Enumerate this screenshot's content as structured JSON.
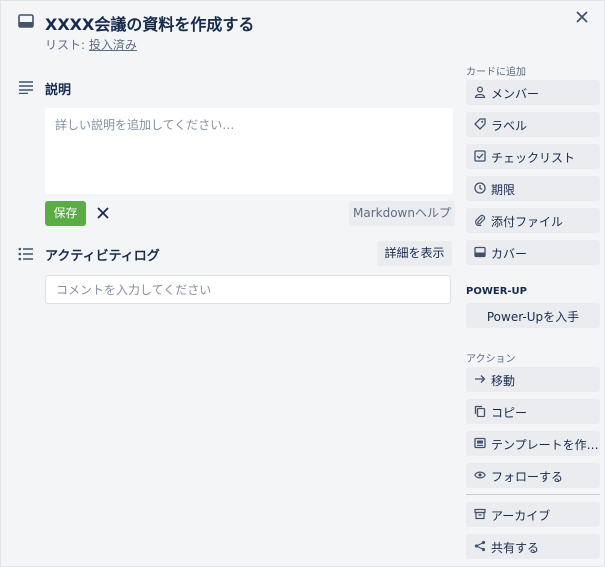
{
  "card": {
    "title": "XXXX会議の資料を作成する",
    "list_prefix": "リスト: ",
    "list_name": "投入済み"
  },
  "description": {
    "heading": "説明",
    "placeholder": "詳しい説明を追加してください…",
    "save_label": "保存",
    "markdown_help_label": "Markdownヘルプ"
  },
  "activity": {
    "heading": "アクティビティログ",
    "show_details_label": "詳細を表示",
    "comment_placeholder": "コメントを入力してください"
  },
  "sidebar": {
    "add_to_card_heading": "カードに追加",
    "add_items": [
      {
        "label": "メンバー",
        "icon": "person-icon"
      },
      {
        "label": "ラベル",
        "icon": "tag-icon"
      },
      {
        "label": "チェックリスト",
        "icon": "checkbox-icon"
      },
      {
        "label": "期限",
        "icon": "clock-icon"
      },
      {
        "label": "添付ファイル",
        "icon": "paperclip-icon"
      },
      {
        "label": "カバー",
        "icon": "cover-icon"
      }
    ],
    "powerup_heading": "POWER-UP",
    "powerup_button": "Power-Upを入手",
    "actions_heading": "アクション",
    "action_items": [
      {
        "label": "移動",
        "icon": "arrow-right-icon"
      },
      {
        "label": "コピー",
        "icon": "copy-icon"
      },
      {
        "label": "テンプレートを作…",
        "icon": "template-icon"
      },
      {
        "label": "フォローする",
        "icon": "eye-icon"
      }
    ],
    "archive_items": [
      {
        "label": "アーカイブ",
        "icon": "archive-icon"
      },
      {
        "label": "共有する",
        "icon": "share-icon"
      }
    ]
  },
  "colors": {
    "save_green": "#5aac44",
    "button_gray": "#ebecf0",
    "background": "#f4f5f7"
  }
}
